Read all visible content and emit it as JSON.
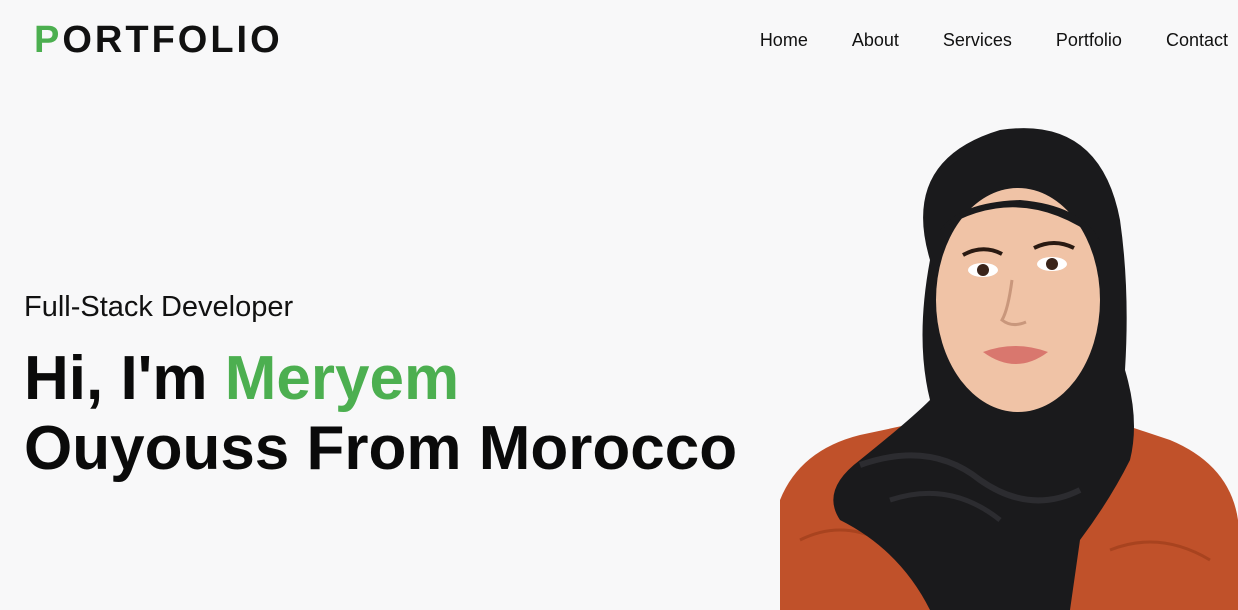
{
  "header": {
    "logo_first": "P",
    "logo_rest": "ORTFOLIO",
    "nav": [
      {
        "label": "Home"
      },
      {
        "label": "About"
      },
      {
        "label": "Services"
      },
      {
        "label": "Portfolio"
      },
      {
        "label": "Contact"
      }
    ]
  },
  "hero": {
    "subtitle": "Full-Stack Developer",
    "greeting": "Hi, I'm ",
    "first_name": "Meryem",
    "line2": "Ouyouss From Morocco"
  },
  "colors": {
    "accent": "#4caf50",
    "background": "#f8f8f9",
    "text": "#111111"
  }
}
